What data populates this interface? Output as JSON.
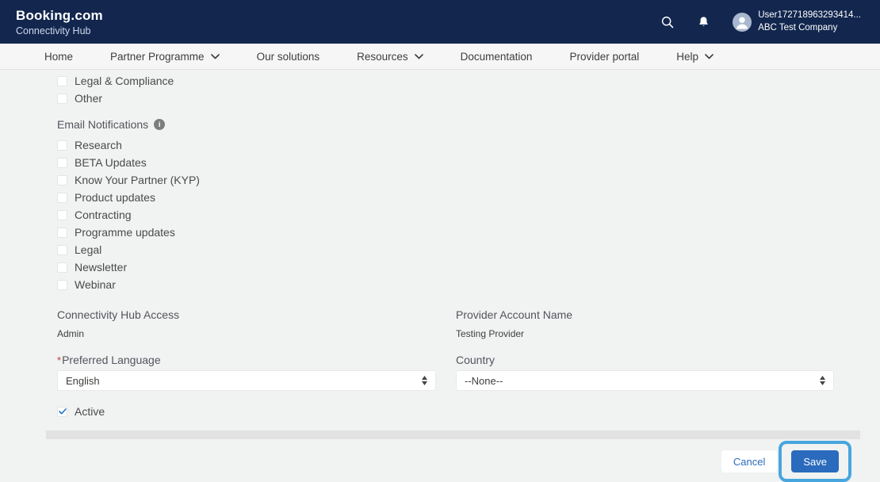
{
  "header": {
    "brand": "Booking.com",
    "subtitle": "Connectivity Hub",
    "user_name": "User172718963293414...",
    "company": "ABC Test Company"
  },
  "nav": {
    "items": [
      {
        "label": "Home",
        "dropdown": false
      },
      {
        "label": "Partner Programme",
        "dropdown": true
      },
      {
        "label": "Our solutions",
        "dropdown": false
      },
      {
        "label": "Resources",
        "dropdown": true
      },
      {
        "label": "Documentation",
        "dropdown": false
      },
      {
        "label": "Provider portal",
        "dropdown": false
      },
      {
        "label": "Help",
        "dropdown": true
      }
    ]
  },
  "form": {
    "topics": [
      "Legal & Compliance",
      "Other"
    ],
    "email_notifications": {
      "label": "Email Notifications",
      "options": [
        "Research",
        "BETA Updates",
        "Know Your Partner (KYP)",
        "Product updates",
        "Contracting",
        "Programme updates",
        "Legal",
        "Newsletter",
        "Webinar"
      ]
    },
    "access": {
      "label": "Connectivity Hub Access",
      "value": "Admin"
    },
    "provider": {
      "label": "Provider Account Name",
      "value": "Testing Provider"
    },
    "language": {
      "label": "Preferred Language",
      "required_marker": "*",
      "value": "English"
    },
    "country": {
      "label": "Country",
      "value": "--None--"
    },
    "active": {
      "label": "Active",
      "checked": true
    }
  },
  "footer": {
    "cancel_label": "Cancel",
    "save_label": "Save"
  },
  "icons": {
    "info_glyph": "i"
  },
  "colors": {
    "header_bg": "#12264e",
    "nav_bg": "#f6f6f6",
    "page_bg": "#f1f2f2",
    "save_blue": "#2a6bbd",
    "cancel_text_blue": "#2a6bbd",
    "check_blue": "#2574cb",
    "required_red": "#c23934",
    "highlight_outline": "#47a6de",
    "scrollbar_gray": "#e2e2e2"
  }
}
